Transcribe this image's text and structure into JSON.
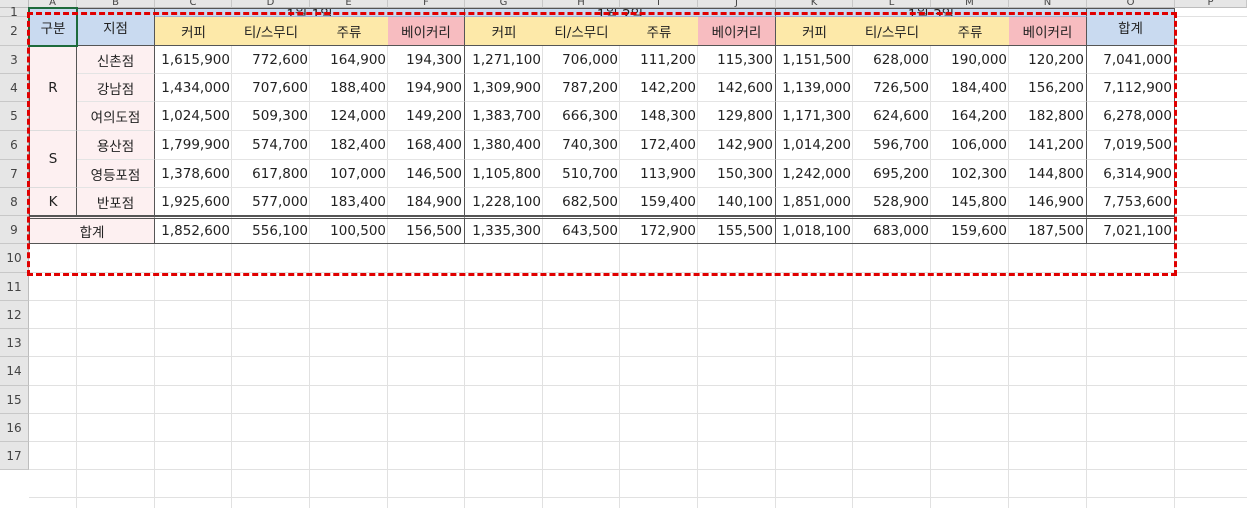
{
  "columns": [
    "A",
    "B",
    "C",
    "D",
    "E",
    "F",
    "G",
    "H",
    "I",
    "J",
    "K",
    "L",
    "M",
    "N",
    "O",
    "P"
  ],
  "rows": [
    "1",
    "2",
    "3",
    "4",
    "5",
    "6",
    "7",
    "8",
    "9",
    "10",
    "11",
    "12",
    "13",
    "14",
    "15",
    "16",
    "17"
  ],
  "headers": {
    "category": "구분",
    "branch": "지점",
    "total": "합계",
    "dates": [
      "1월 1일",
      "1월 2일",
      "1월 3일"
    ],
    "products": [
      "커피",
      "티/스무디",
      "주류",
      "베이커리"
    ]
  },
  "groups": [
    "R",
    "S",
    "K"
  ],
  "branches": [
    {
      "name": "신촌점",
      "values": [
        "1,615,900",
        "772,600",
        "164,900",
        "194,300",
        "1,271,100",
        "706,000",
        "111,200",
        "115,300",
        "1,151,500",
        "628,000",
        "190,000",
        "120,200"
      ],
      "total": "7,041,000"
    },
    {
      "name": "강남점",
      "values": [
        "1,434,000",
        "707,600",
        "188,400",
        "194,900",
        "1,309,900",
        "787,200",
        "142,200",
        "142,600",
        "1,139,000",
        "726,500",
        "184,400",
        "156,200"
      ],
      "total": "7,112,900"
    },
    {
      "name": "여의도점",
      "values": [
        "1,024,500",
        "509,300",
        "124,000",
        "149,200",
        "1,383,700",
        "666,300",
        "148,300",
        "129,800",
        "1,171,300",
        "624,600",
        "164,200",
        "182,800"
      ],
      "total": "6,278,000"
    },
    {
      "name": "용산점",
      "values": [
        "1,799,900",
        "574,700",
        "182,400",
        "168,400",
        "1,380,400",
        "740,300",
        "172,400",
        "142,900",
        "1,014,200",
        "596,700",
        "106,000",
        "141,200"
      ],
      "total": "7,019,500"
    },
    {
      "name": "영등포점",
      "values": [
        "1,378,600",
        "617,800",
        "107,000",
        "146,500",
        "1,105,800",
        "510,700",
        "113,900",
        "150,300",
        "1,242,000",
        "695,200",
        "102,300",
        "144,800"
      ],
      "total": "6,314,900"
    },
    {
      "name": "반포점",
      "values": [
        "1,925,600",
        "577,000",
        "183,400",
        "184,900",
        "1,228,100",
        "682,500",
        "159,400",
        "140,100",
        "1,851,000",
        "528,900",
        "145,800",
        "146,900"
      ],
      "total": "7,753,600"
    }
  ],
  "summary": {
    "label": "합계",
    "values": [
      "1,852,600",
      "556,100",
      "100,500",
      "156,500",
      "1,335,300",
      "643,500",
      "172,900",
      "155,500",
      "1,018,100",
      "683,000",
      "159,600",
      "187,500"
    ],
    "total": "7,021,100"
  },
  "colors": {
    "header_blue": "#c9daf0",
    "header_yellow": "#fde9a9",
    "header_red": "#f7bcc0",
    "row_pink": "#fdf0f1",
    "highlight_dash": "#e00000",
    "selection": "#1e6b3c"
  }
}
